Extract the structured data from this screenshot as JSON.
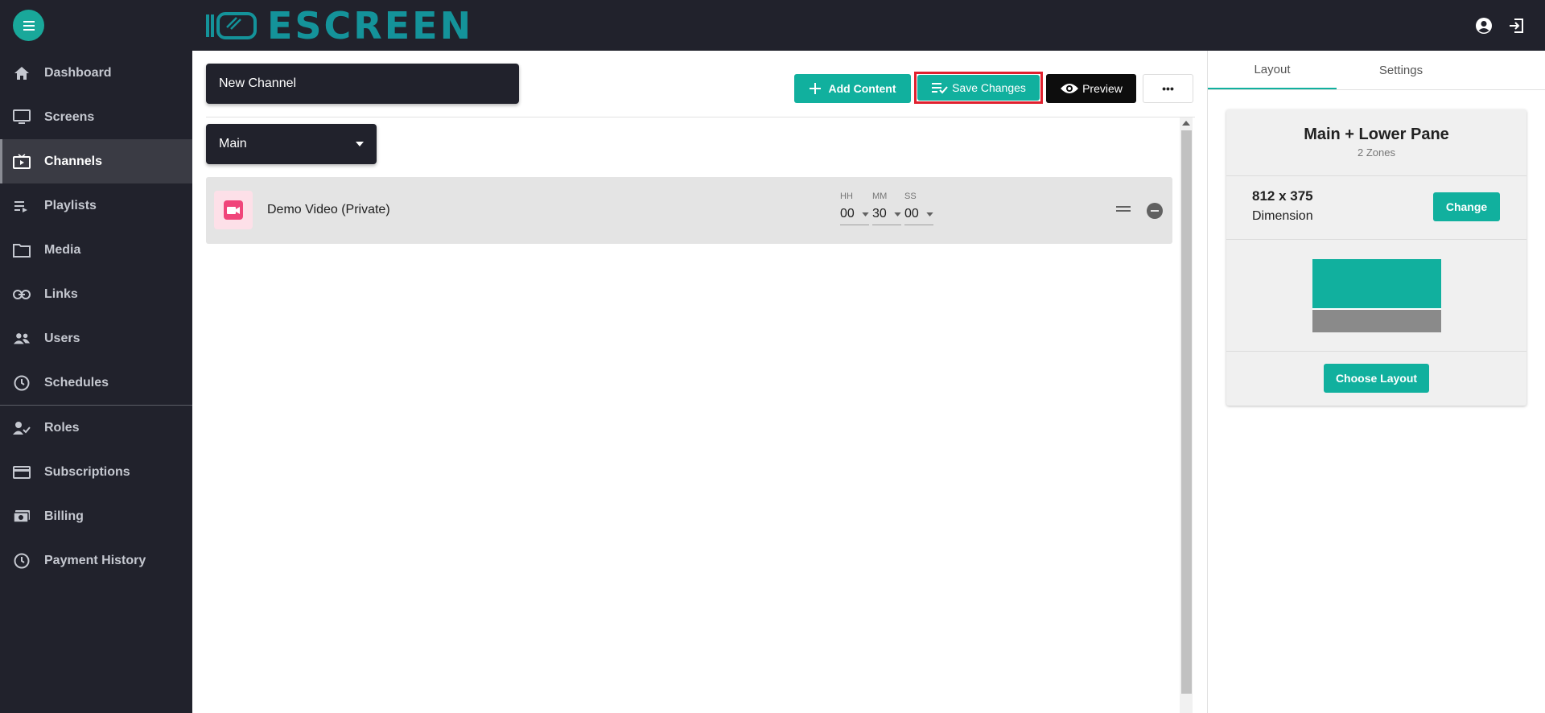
{
  "app": {
    "logo_text": "ESCREEN",
    "logo_color": "#14939a",
    "accent_color": "#11b09e",
    "icons": {
      "menu": "hamburger-menu-icon",
      "account": "account-circle-icon",
      "logout": "logout-icon"
    }
  },
  "sidebar": {
    "items": [
      {
        "label": "Dashboard",
        "icon": "home-icon"
      },
      {
        "label": "Screens",
        "icon": "monitor-icon"
      },
      {
        "label": "Channels",
        "icon": "tv-play-icon",
        "active": true
      },
      {
        "label": "Playlists",
        "icon": "playlist-icon"
      },
      {
        "label": "Media",
        "icon": "folder-icon"
      },
      {
        "label": "Links",
        "icon": "link-icon"
      },
      {
        "label": "Users",
        "icon": "users-icon"
      },
      {
        "label": "Schedules",
        "icon": "clock-icon"
      },
      {
        "label": "Roles",
        "icon": "user-check-icon"
      },
      {
        "label": "Subscriptions",
        "icon": "credit-card-icon"
      },
      {
        "label": "Billing",
        "icon": "cash-icon"
      },
      {
        "label": "Payment History",
        "icon": "history-icon"
      }
    ]
  },
  "channel": {
    "name": "New Channel"
  },
  "toolbar": {
    "add_content_label": "Add Content",
    "save_changes_label": "Save Changes",
    "preview_label": "Preview",
    "more_label": "•••"
  },
  "zone_select": {
    "value": "Main"
  },
  "content_items": [
    {
      "title": "Demo Video (Private)",
      "icon": "video-camera-icon",
      "hh_label": "HH",
      "mm_label": "MM",
      "ss_label": "SS",
      "hh": "00",
      "mm": "30",
      "ss": "00"
    }
  ],
  "right_panel": {
    "tabs": [
      {
        "label": "Layout",
        "active": true
      },
      {
        "label": "Settings",
        "active": false
      }
    ],
    "layout_card": {
      "title": "Main + Lower Pane",
      "zones": "2 Zones",
      "dimension_value": "812 x 375",
      "dimension_label": "Dimension",
      "change_label": "Change",
      "choose_layout_label": "Choose Layout",
      "preview_main_color": "#11b09e",
      "preview_lower_color": "#8a8a8a",
      "preview_main_fraction": 0.69
    }
  }
}
